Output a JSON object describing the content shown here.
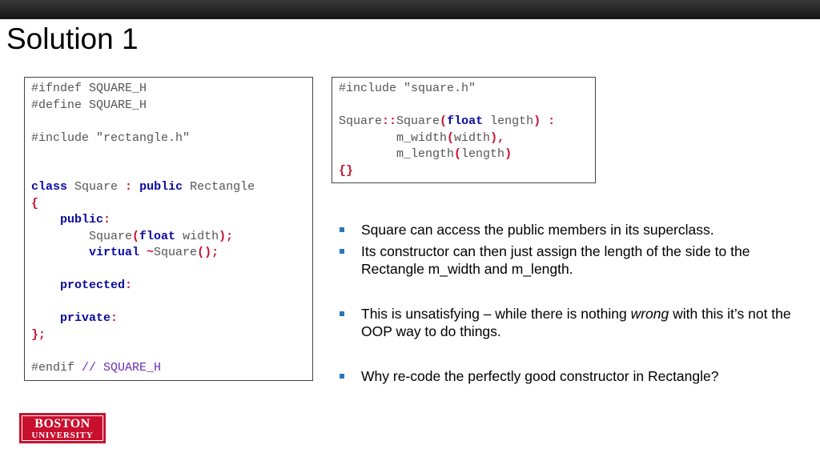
{
  "slide": {
    "title": "Solution 1"
  },
  "code_left": {
    "l1": "#ifndef SQUARE_H",
    "l2": "#define SQUARE_H",
    "l3": "#include \"rectangle.h\"",
    "l4_kw_class": "class",
    "l4_name": " Square ",
    "l4_colon": ":",
    "l4_kw_public": "public",
    "l4_base": " Rectangle",
    "l5": "{",
    "l6_kw": "public",
    "l6_colon": ":",
    "l7_name": "Square",
    "l7_open": "(",
    "l7_kw": "float",
    "l7_arg": " width",
    "l7_close": ");",
    "l8_kw": "virtual",
    "l8_tilde": " ~",
    "l8_name": "Square",
    "l8_close": "();",
    "l9_kw": "protected",
    "l9_colon": ":",
    "l10_kw": "private",
    "l10_colon": ":",
    "l11": "};",
    "l12_endif": "#endif",
    "l12_comment": " // SQUARE_H"
  },
  "code_right": {
    "l1": "#include \"square.h\"",
    "l2_a": "Square",
    "l2_b": "::",
    "l2_c": "Square",
    "l2_d": "(",
    "l2_e": "float",
    "l2_f": " length",
    "l2_g": ")",
    "l2_h": " :",
    "l3_a": "m_width",
    "l3_b": "(",
    "l3_c": "width",
    "l3_d": "),",
    "l4_a": "m_length",
    "l4_b": "(",
    "l4_c": "length",
    "l4_d": ")",
    "l5": "{}"
  },
  "bullets": {
    "b1": "Square can access the public members in its superclass.",
    "b2": "Its constructor can then just assign the length of the side to the Rectangle m_width and m_length.",
    "b3_pre": "This is unsatisfying – while there is nothing ",
    "b3_em": "wrong",
    "b3_post": " with this it’s not the OOP way to do things.",
    "b4": "Why re-code the perfectly good constructor in Rectangle?"
  },
  "logo": {
    "line1": "BOSTON",
    "line2": "UNIVERSITY"
  },
  "colors": {
    "keyword": "#0a0aa0",
    "operator": "#c8102e",
    "comment": "#6b2fb8",
    "bullet": "#2e75b6",
    "logo_bg": "#c8102e"
  }
}
